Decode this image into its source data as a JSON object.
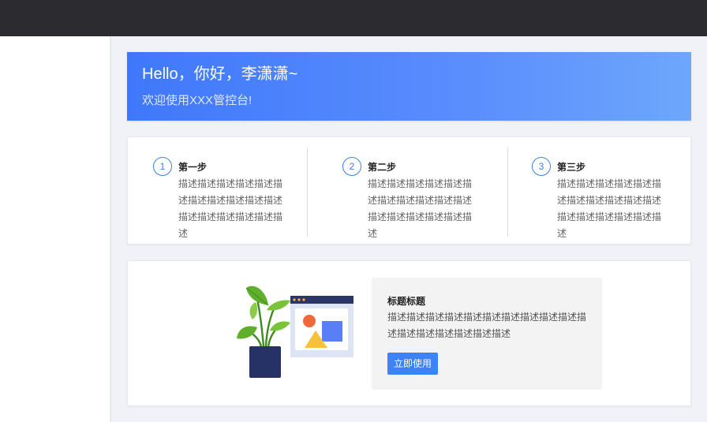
{
  "banner": {
    "greeting": "Hello，你好，李潇潇~",
    "welcome": "欢迎使用XXX管控台!"
  },
  "steps": [
    {
      "number": "1",
      "title": "第一步",
      "description": "描述描述描述描述描述描述描述描述描述描述描述描述描述描述描述描述描述"
    },
    {
      "number": "2",
      "title": "第二步",
      "description": "描述描述描述描述描述描述描述描述描述描述描述描述描述描述描述描述描述"
    },
    {
      "number": "3",
      "title": "第三步",
      "description": "描述描述描述描述描述描述描述描述描述描述描述描述描述描述描述描述描述"
    }
  ],
  "promo": {
    "title": "标题标题",
    "description": "描述描述描述描述描述描述描述描述描述描述描述描述描述描述描述描述描述",
    "button_label": "立即使用",
    "illustration": "plant-and-browser-window-illustration"
  },
  "colors": {
    "topbar": "#2c2c30",
    "accent": "#3d82f6",
    "banner_start": "#3f78fb",
    "banner_end": "#6da7fc"
  }
}
